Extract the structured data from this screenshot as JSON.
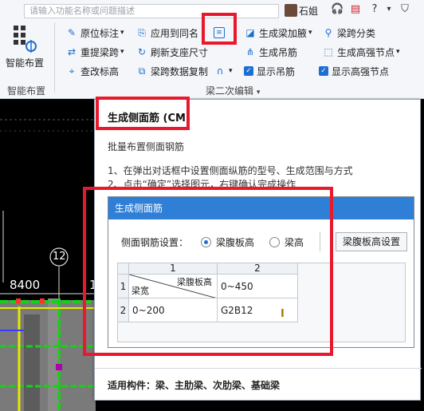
{
  "search": {
    "placeholder": "请输入功能名称或问题描述"
  },
  "user": {
    "name": "石姐"
  },
  "top_icons": [
    "headset-icon",
    "calendar-icon",
    "help-icon",
    "shirt-icon"
  ],
  "top_icon_glyphs": [
    "🎧",
    "▤",
    "?",
    "⛉"
  ],
  "ribbon": {
    "big_tool": {
      "label": "智能布置"
    },
    "group_smart_label": "智能布置",
    "group_edit_label": "梁二次编辑",
    "tools": {
      "in_place_label": "原位标注",
      "apply_same_name": "应用到同名",
      "gen_haunch": "生成梁加腋",
      "span_class": "梁跨分类",
      "repick_span": "重提梁跨",
      "refresh_support": "刷新支座尺寸",
      "gen_hanger": "生成吊筋",
      "gen_high_strength": "生成高强节点",
      "check_label": "查改标高",
      "span_copy": "梁跨数据复制",
      "show_hanger": "显示吊筋",
      "show_high_strength": "显示高强节点"
    }
  },
  "canvas": {
    "dimension": "8400",
    "axis_label": "12",
    "axis_label_right": "12"
  },
  "tooltip": {
    "title": "生成侧面筋 (CM)",
    "description": "批量布置侧面钢筋",
    "steps": [
      "1、在弹出对话框中设置侧面纵筋的型号、生成范围与方式",
      "2、点击“确定”选择图元，右键确认完成操作"
    ],
    "applicable": "适用构件：梁、主肋梁、次肋梁、基础梁"
  },
  "dialog": {
    "title": "生成侧面筋",
    "setting_label": "侧面钢筋设置：",
    "option_web_height": "梁腹板高",
    "option_beam_height": "梁高",
    "selected_option": "梁腹板高",
    "settings_button": "梁腹板高设置",
    "table": {
      "col_headers": [
        "1",
        "2"
      ],
      "row_headers": [
        "1",
        "2"
      ],
      "corner_top": "梁腹板高",
      "corner_bottom": "梁宽",
      "rows": [
        [
          "",
          "0~450"
        ],
        [
          "0~200",
          "G2B12"
        ]
      ]
    }
  },
  "colors": {
    "accent": "#2f7fd6",
    "highlight_red": "#e8192c",
    "cad_yellow": "#e8e800",
    "cad_green": "#18d018",
    "cad_gray": "#7a7a7a",
    "cad_purple": "#b000b0"
  }
}
